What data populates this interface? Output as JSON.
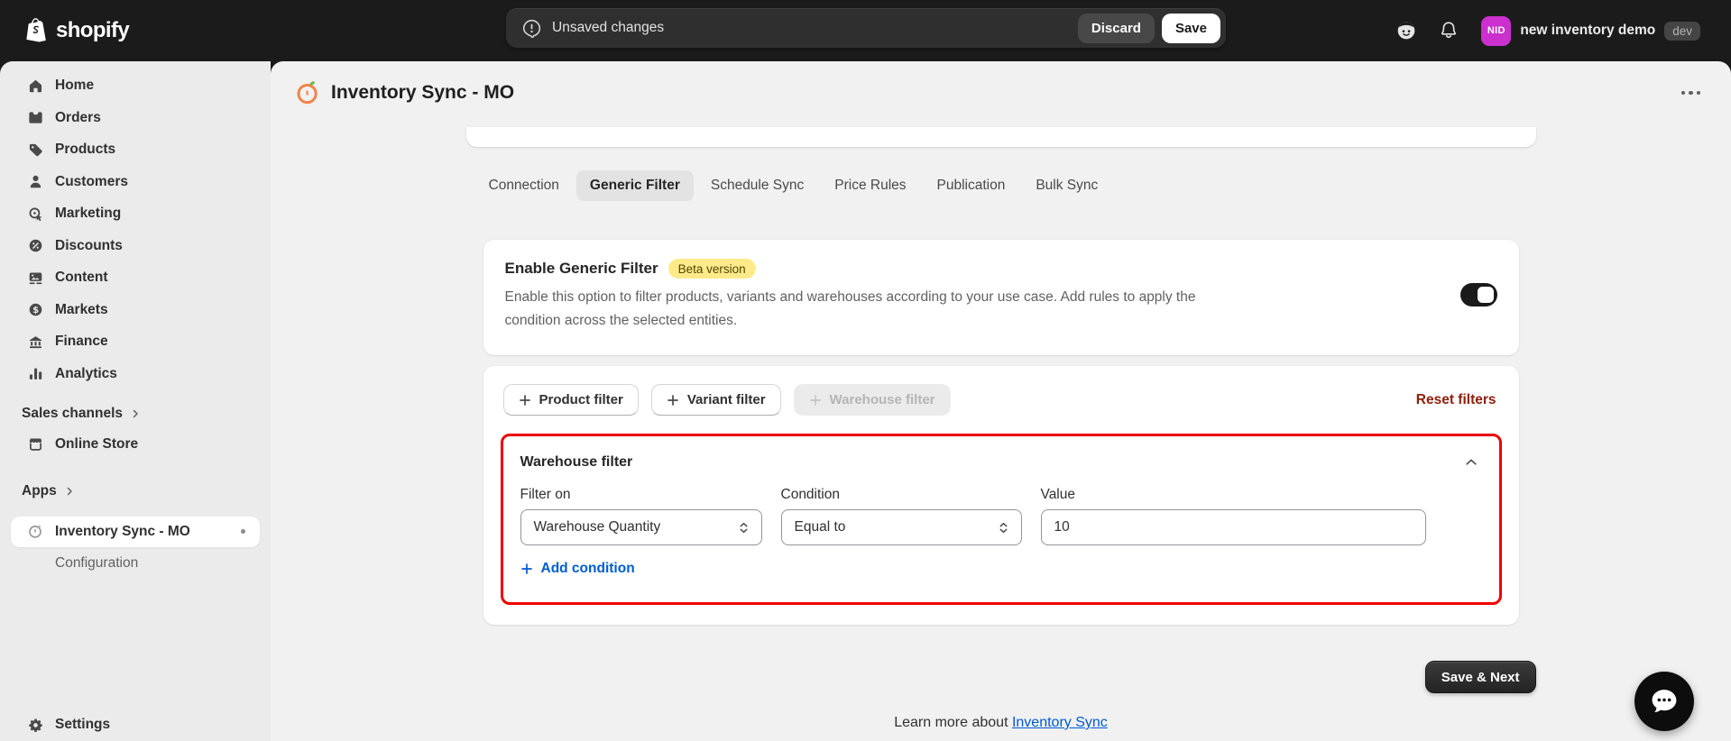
{
  "topbar": {
    "logo_text": "shopify",
    "save_bar": {
      "message": "Unsaved changes",
      "discard_label": "Discard",
      "save_label": "Save"
    },
    "icon_buttons": [
      {
        "icon": "sidekick-icon"
      },
      {
        "icon": "bell-icon"
      }
    ],
    "store": {
      "initials": "NID",
      "name": "new inventory demo",
      "badge": "dev"
    }
  },
  "sidebar": {
    "items": [
      {
        "label": "Home",
        "icon": "home-icon"
      },
      {
        "label": "Orders",
        "icon": "orders-icon"
      },
      {
        "label": "Products",
        "icon": "tag-icon"
      },
      {
        "label": "Customers",
        "icon": "person-icon"
      },
      {
        "label": "Marketing",
        "icon": "target-icon"
      },
      {
        "label": "Discounts",
        "icon": "discount-icon"
      },
      {
        "label": "Content",
        "icon": "image-icon"
      },
      {
        "label": "Markets",
        "icon": "globe-dollar-icon"
      },
      {
        "label": "Finance",
        "icon": "bank-icon"
      },
      {
        "label": "Analytics",
        "icon": "bar-chart-icon"
      }
    ],
    "sales_channels_header": "Sales channels",
    "sales_channels": [
      {
        "label": "Online Store",
        "icon": "storefront-icon"
      }
    ],
    "apps_header": "Apps",
    "apps": [
      {
        "label": "Inventory Sync - MO",
        "icon": "gauge-icon",
        "active": true
      }
    ],
    "app_subitems": [
      {
        "label": "Configuration"
      }
    ],
    "settings": {
      "label": "Settings",
      "icon": "gear-icon"
    }
  },
  "page": {
    "title": "Inventory Sync - MO",
    "tabs": [
      "Connection",
      "Generic Filter",
      "Schedule Sync",
      "Price Rules",
      "Publication",
      "Bulk Sync"
    ],
    "active_tab": "Generic Filter",
    "enable_card": {
      "title": "Enable Generic Filter",
      "badge": "Beta version",
      "description": "Enable this option to filter products, variants and warehouses according to your use case. Add rules to apply the condition across the selected entities.",
      "toggle_on": true
    },
    "filters_card": {
      "buttons": [
        {
          "label": "Product filter",
          "disabled": false
        },
        {
          "label": "Variant filter",
          "disabled": false
        },
        {
          "label": "Warehouse filter",
          "disabled": true
        }
      ],
      "reset_label": "Reset filters",
      "warehouse_section": {
        "title": "Warehouse filter",
        "highlighted": true,
        "fields": [
          {
            "label": "Filter on",
            "value": "Warehouse Quantity",
            "type": "select"
          },
          {
            "label": "Condition",
            "value": "Equal to",
            "type": "select"
          },
          {
            "label": "Value",
            "value": "10",
            "type": "input"
          }
        ],
        "add_condition_label": "Add condition"
      }
    },
    "save_next_label": "Save & Next",
    "footer": {
      "prefix": "Learn more about ",
      "link": "Inventory Sync"
    }
  },
  "colors": {
    "topbar_bg": "#1b1b1b",
    "sidebar_bg": "#ebebeb",
    "main_bg": "#f1f1f1",
    "card_bg": "#ffffff",
    "link_blue": "#005BD3",
    "critical_red_link": "#8e1f0b",
    "highlight_border_red": "#ef0000",
    "beta_badge_bg": "#ffea8a",
    "beta_badge_text": "#4f4700",
    "avatar_bg": "#cb30cf",
    "toggle_on": "#1a1a1a",
    "selected_tab_bg": "#e3e3e3"
  }
}
